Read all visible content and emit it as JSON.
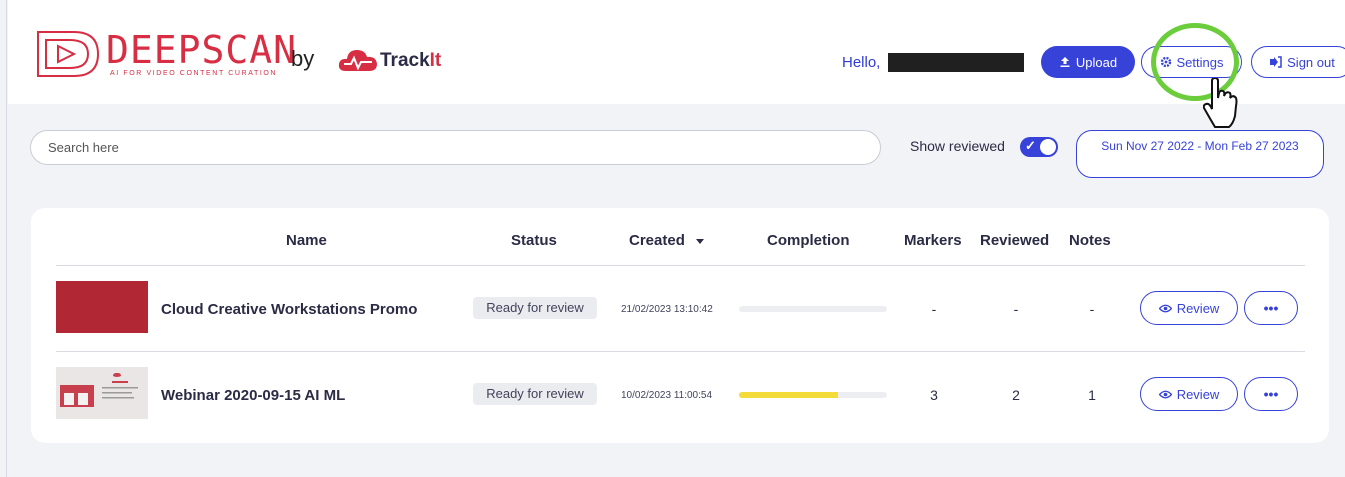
{
  "header": {
    "brand_name": "DEEPSCAN",
    "brand_tagline": "AI FOR VIDEO CONTENT CURATION",
    "by_label": "by",
    "partner_name_main": "Track",
    "partner_name_accent": "It",
    "greeting": "Hello,",
    "upload_label": "Upload",
    "settings_label": "Settings",
    "signout_label": "Sign out"
  },
  "filters": {
    "search_placeholder": "Search here",
    "show_reviewed_label": "Show reviewed",
    "show_reviewed_on": true,
    "date_range": "Sun Nov 27 2022 - Mon Feb 27 2023"
  },
  "table": {
    "columns": {
      "name": "Name",
      "status": "Status",
      "created": "Created",
      "completion": "Completion",
      "markers": "Markers",
      "reviewed": "Reviewed",
      "notes": "Notes"
    },
    "rows": [
      {
        "name": "Cloud Creative Workstations Promo",
        "status": "Ready for review",
        "created": "21/02/2023 13:10:42",
        "completion": 0,
        "markers": "-",
        "reviewed": "-",
        "notes": "-",
        "review_label": "Review",
        "more_label": "•••"
      },
      {
        "name": "Webinar 2020-09-15 AI ML",
        "status": "Ready for review",
        "created": "10/02/2023 11:00:54",
        "completion": 0.67,
        "markers": "3",
        "reviewed": "2",
        "notes": "1",
        "review_label": "Review",
        "more_label": "•••"
      }
    ]
  },
  "colors": {
    "brand_red": "#d72e44",
    "accent_blue": "#3742d8",
    "highlight_green": "#6ccd3c",
    "progress_yellow": "#f3dc3a"
  },
  "icons": [
    "deepscan-logo-icon",
    "trackit-cloud-icon",
    "upload-icon",
    "gear-icon",
    "sign-out-icon",
    "check-icon",
    "sort-down-icon",
    "eye-icon",
    "more-icon",
    "hand-cursor-icon"
  ]
}
